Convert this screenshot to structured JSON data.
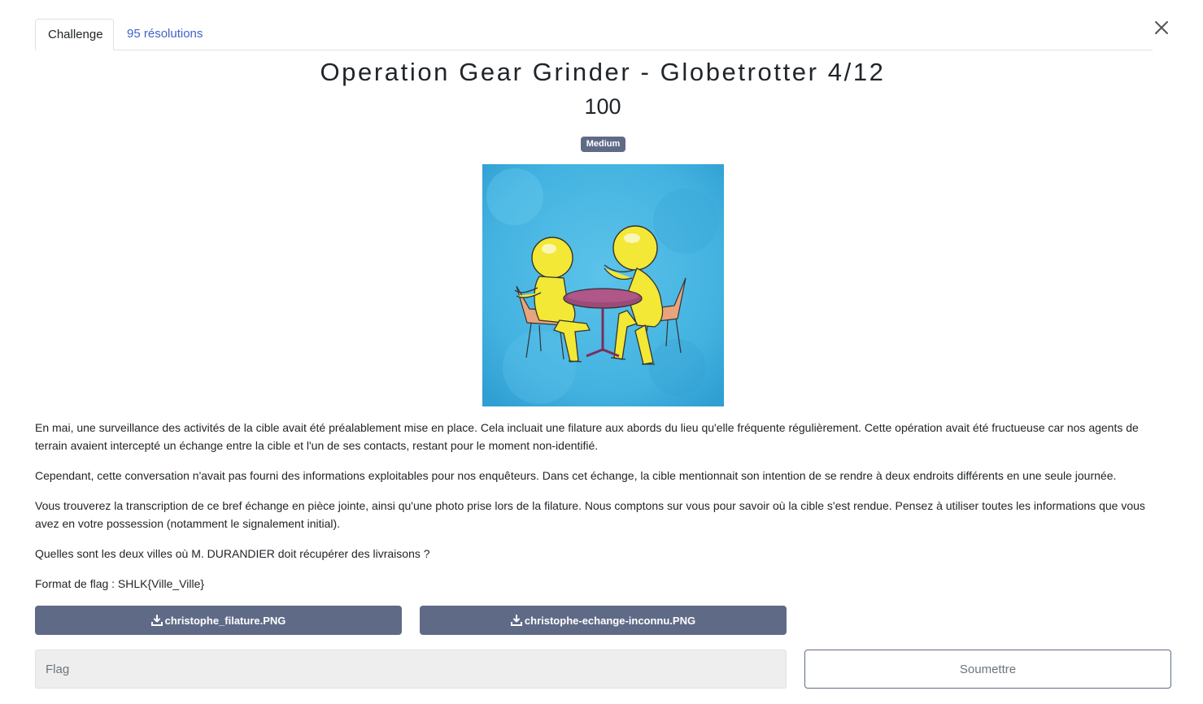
{
  "tabs": [
    {
      "label": "Challenge",
      "active": true
    },
    {
      "label": "95 résolutions",
      "active": false
    }
  ],
  "challenge": {
    "title": "Operation Gear Grinder - Globetrotter 4/12",
    "points": "100",
    "difficulty": "Medium"
  },
  "description": {
    "paragraphs": [
      "En mai, une surveillance des activités de la cible avait été préalablement mise en place. Cela incluait une filature aux abords du lieu qu'elle fréquente régulièrement. Cette opération avait été fructueuse car nos agents de terrain avaient intercepté un échange entre la cible et l'un de ses contacts, restant pour le moment non-identifié.",
      "Cependant, cette conversation n'avait pas fourni des informations exploitables pour nos enquêteurs. Dans cet échange, la cible mentionnait son intention de se rendre à deux endroits différents en une seule journée.",
      "Vous trouverez la transcription de ce bref échange en pièce jointe, ainsi qu'une photo prise lors de la filature. Nous comptons sur vous pour savoir où la cible s'est rendue. Pensez à utiliser toutes les informations que vous avez en votre possession (notamment le signalement initial).",
      "Quelles sont les deux villes où M. DURANDIER doit récupérer des livraisons ?",
      "Format de flag : SHLK{Ville_Ville}"
    ]
  },
  "files": [
    {
      "name": "christophe_filature.PNG",
      "icon": "download-icon"
    },
    {
      "name": "christophe-echange-inconnu.PNG",
      "icon": "download-icon"
    }
  ],
  "submission": {
    "placeholder": "Flag",
    "value": "",
    "submit_label": "Soumettre"
  },
  "colors": {
    "accent": "#5f6b86",
    "link": "#3e63c9",
    "illustration_bg": "#45b6e3"
  },
  "icons": {
    "close": "close-icon"
  }
}
